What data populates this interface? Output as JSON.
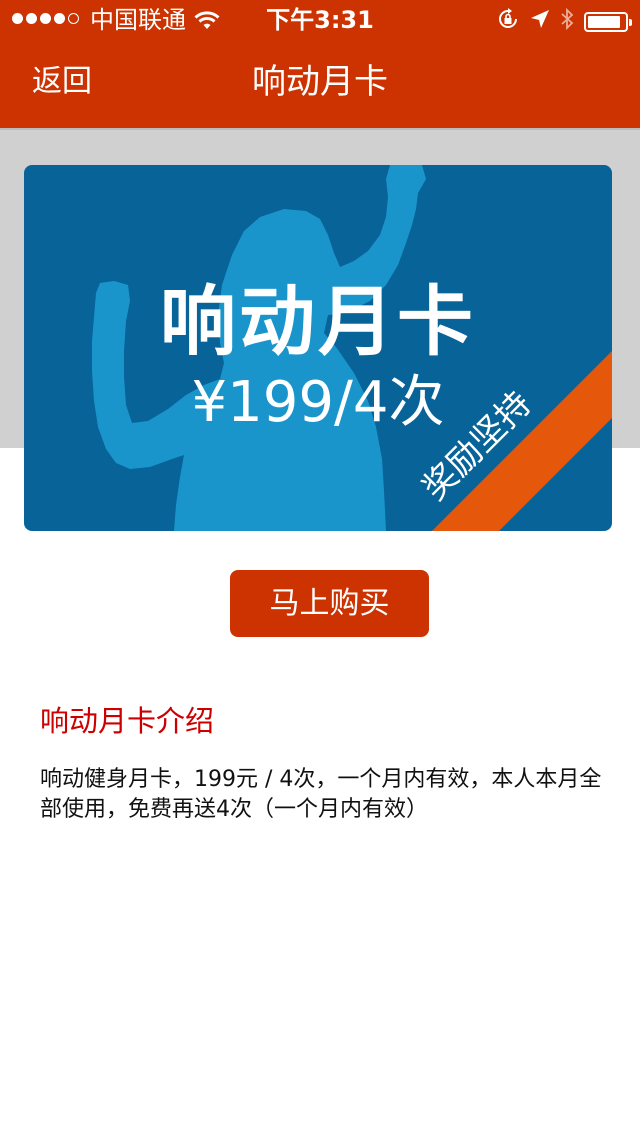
{
  "status_bar": {
    "signal_bars_filled": 4,
    "signal_bars_total": 5,
    "carrier": "中国联通",
    "time": "下午3:31",
    "icons": [
      "wifi-icon",
      "orientation-lock-icon",
      "location-arrow-icon",
      "bluetooth-icon",
      "battery-icon"
    ],
    "battery_level": 0.9
  },
  "nav": {
    "back_label": "返回",
    "title": "响动月卡"
  },
  "card": {
    "title": "响动月卡",
    "price": "¥199/4次",
    "ribbon": "奖励坚持",
    "colors": {
      "background": "#086399",
      "figure": "#1a95cc",
      "ribbon": "#e5580c"
    }
  },
  "buy_button": {
    "label": "马上购买"
  },
  "intro": {
    "heading": "响动月卡介绍",
    "body": "响动健身月卡，199元 / 4次，一个月内有效，本人本月全部使用，免费再送4次（一个月内有效）"
  },
  "colors": {
    "brand_red": "#cc3300",
    "heading_red": "#cc0000"
  }
}
